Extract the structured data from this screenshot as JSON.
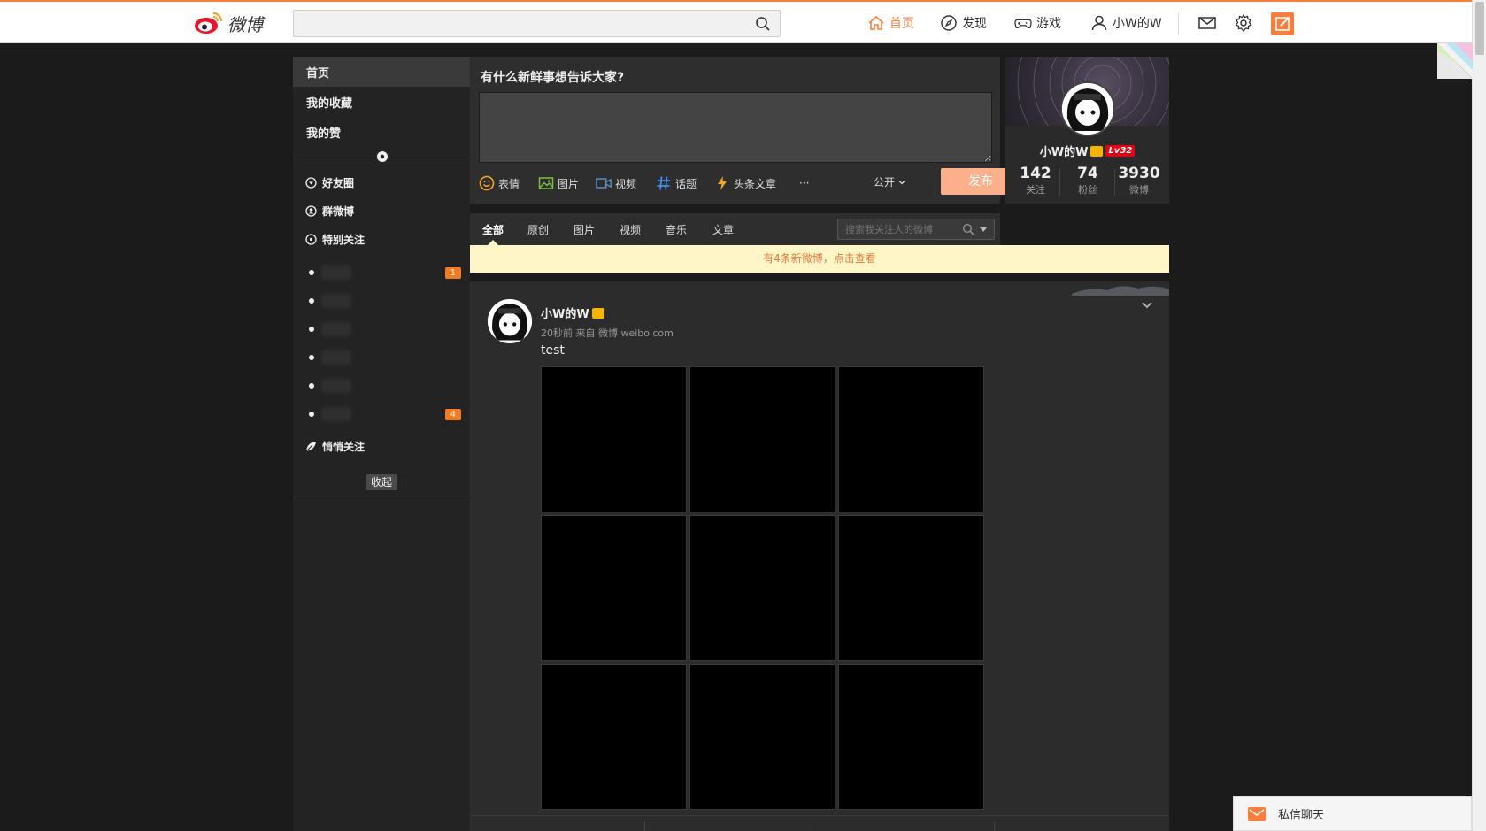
{
  "header": {
    "logo_text": "微博",
    "search_placeholder": "",
    "nav": [
      {
        "label": "首页",
        "icon": "home-icon",
        "active": true
      },
      {
        "label": "发现",
        "icon": "compass-icon",
        "active": false
      },
      {
        "label": "游戏",
        "icon": "gamepad-icon",
        "active": false
      },
      {
        "label": "小W的W",
        "icon": "user-icon",
        "active": false
      }
    ],
    "accent_color": "#fa7d3c"
  },
  "sidebar": {
    "items": [
      {
        "label": "首页"
      },
      {
        "label": "我的收藏"
      },
      {
        "label": "我的赞"
      }
    ],
    "subs": [
      {
        "label": "好友圈"
      },
      {
        "label": "群微博"
      },
      {
        "label": "特别关注"
      }
    ],
    "group_badges": [
      "1",
      "4"
    ],
    "quiet_follow": "悄悄关注",
    "collapse": "收起"
  },
  "composer": {
    "title": "有什么新鲜事想告诉大家?",
    "tools": [
      {
        "label": "表情",
        "icon": "emoji-icon"
      },
      {
        "label": "图片",
        "icon": "image-icon"
      },
      {
        "label": "视频",
        "icon": "video-icon"
      },
      {
        "label": "话题",
        "icon": "hashtag-icon"
      },
      {
        "label": "头条文章",
        "icon": "lightning-icon"
      },
      {
        "label": "···",
        "icon": "more-icon"
      }
    ],
    "visibility": "公开",
    "publish": "发布"
  },
  "profile": {
    "name": "小W的W",
    "level": "Lv32",
    "stats": [
      {
        "num": "142",
        "label": "关注"
      },
      {
        "num": "74",
        "label": "粉丝"
      },
      {
        "num": "3930",
        "label": "微博"
      }
    ]
  },
  "feed": {
    "tabs": [
      "全部",
      "原创",
      "图片",
      "视频",
      "音乐",
      "文章"
    ],
    "search_placeholder": "搜索我关注人的微博",
    "notice": "有4条新微博，点击查看"
  },
  "post": {
    "author": "小W的W",
    "meta": "20秒前 来自 微博 weibo.com",
    "text": "test",
    "image_count": 9
  },
  "chat": {
    "label": "私信聊天"
  }
}
